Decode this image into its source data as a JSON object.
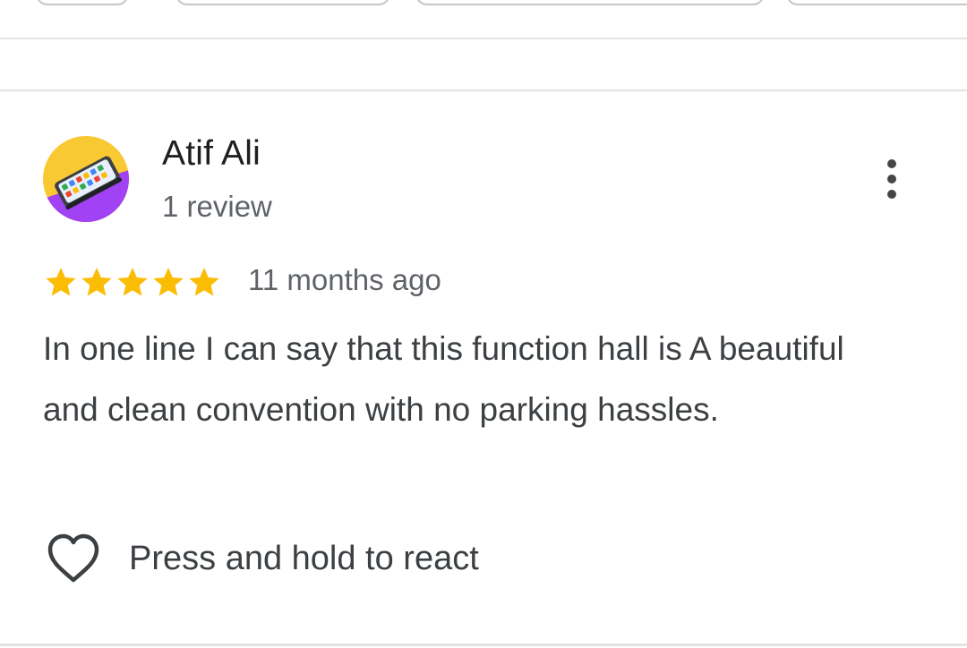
{
  "review": {
    "reviewer_name": "Atif Ali",
    "review_count": "1 review",
    "rating": 5,
    "rating_max": 5,
    "time_ago": "11 months ago",
    "text": "In one line I can say that this function hall is A beautiful and clean convention with no parking hassles.",
    "react_label": "Press and hold to react"
  },
  "icons": {
    "avatar": "phone-avatar-icon",
    "more": "more-vert-icon",
    "star": "star-icon",
    "react": "heart-outline-icon"
  },
  "colors": {
    "star": "#fbbc04",
    "avatar_top": "#f9c933",
    "avatar_bottom": "#a142f4"
  }
}
